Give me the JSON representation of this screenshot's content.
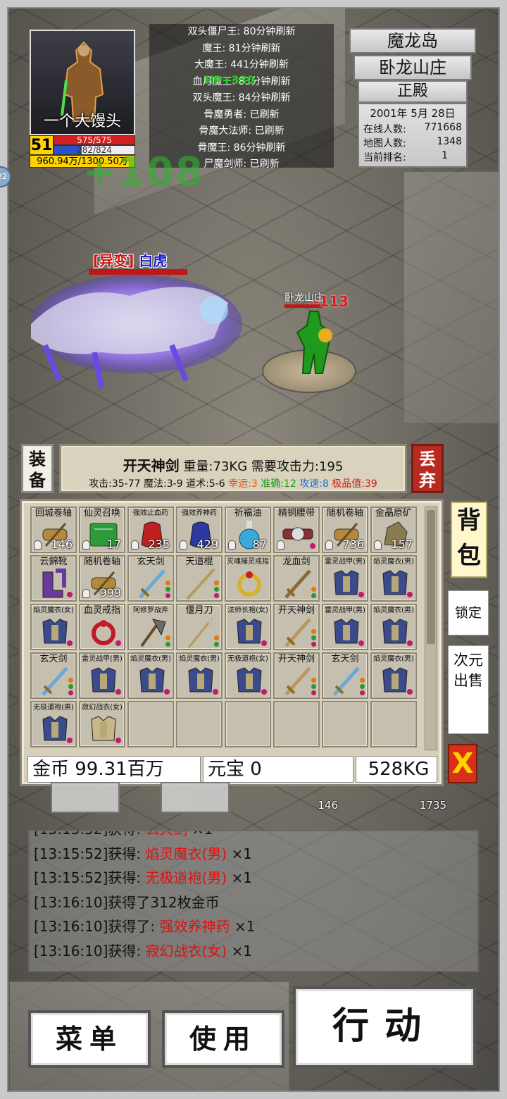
{
  "player": {
    "name": "一个大馒头",
    "level": "51",
    "hp": "575/575",
    "mp": "282/824",
    "exp": "960.94万/1300.50万"
  },
  "timers": [
    "双头僵尸王: 80分钟刷新",
    "魔王: 81分钟刷新",
    "大魔王: 441分钟刷新",
    "血月魔王: 83分钟刷新",
    "双头魔王: 84分钟刷新",
    "骨魔勇者: 已刷新",
    "骨魔大法师: 已刷新",
    "骨魔王: 86分钟刷新",
    "尸魔剑师: 已刷新"
  ],
  "location": {
    "region": "魔龙岛",
    "area": "卧龙山庄",
    "room": "正殿"
  },
  "info": {
    "date": "2001年 5月 28日",
    "online_label": "在线人数:",
    "online_value": "771668",
    "map_label": "地图人数:",
    "map_value": "1348",
    "rank_label": "当前排名:",
    "rank_value": "1"
  },
  "scene": {
    "float_gain": "HP+330",
    "float_big": "+108",
    "monster_tag": "[异变]",
    "monster_name": "白虎",
    "player_label": "卧龙山庄",
    "damage": "-113",
    "edge_badge": "22"
  },
  "item_panel": {
    "equip_label": "装备",
    "drop_label": "丢弃",
    "name": "开天神剑",
    "weight": "重量:73KG",
    "requirement": "需要攻击力:195",
    "attack": "攻击:35-77",
    "magic": "魔法:3-9",
    "tao": "道术:5-6",
    "luck": "幸运:3",
    "accuracy": "准确:12",
    "speed": "攻速:8",
    "grade": "极品值:39"
  },
  "inventory": [
    {
      "name": "回城卷轴",
      "qty": "146",
      "lock": true,
      "icon": "scroll-icon",
      "color": "#b48a3a"
    },
    {
      "name": "仙灵召唤",
      "qty": "17",
      "lock": true,
      "icon": "book-icon",
      "color": "#2e9a3a"
    },
    {
      "name": "强效止血药",
      "qty": "235",
      "lock": true,
      "icon": "potion-bag-icon",
      "color": "#c02020",
      "small": true
    },
    {
      "name": "强效养神药",
      "qty": "429",
      "lock": true,
      "icon": "potion-bag-icon",
      "color": "#2a3aa0",
      "small": true
    },
    {
      "name": "祈福油",
      "qty": "87",
      "lock": true,
      "icon": "flask-icon",
      "color": "#3aa8d8"
    },
    {
      "name": "精铜腰带",
      "lock": true,
      "icon": "belt-icon",
      "color": "#8a3030",
      "dot": "#c01a6a"
    },
    {
      "name": "随机卷轴",
      "qty": "736",
      "lock": true,
      "icon": "scroll-icon",
      "color": "#b48a3a"
    },
    {
      "name": "金晶原矿",
      "qty": "157",
      "lock": true,
      "icon": "ore-icon",
      "color": "#8a7a50"
    },
    {
      "name": "云錦靴",
      "icon": "boots-icon",
      "color": "#6a3a9a",
      "dot": "#c01a6a"
    },
    {
      "name": "随机卷轴",
      "qty": "999",
      "lock": true,
      "icon": "scroll-icon",
      "color": "#b48a3a"
    },
    {
      "name": "玄天剑",
      "icon": "sword-icon",
      "color": "#6aa8d8",
      "dots": [
        "#e07a10",
        "#2a9a2a",
        "#c01a6a"
      ]
    },
    {
      "name": "天道棍",
      "icon": "staff-icon",
      "color": "#b89a5a",
      "dots": [
        "#e07a10",
        "#2a9a2a",
        "#c01a6a"
      ]
    },
    {
      "name": "灭魂摧灵戒指",
      "icon": "ring-icon",
      "color": "#d8b030",
      "small": true
    },
    {
      "name": "龙血剑",
      "icon": "sword-icon",
      "color": "#8a6a3a",
      "dots": [
        "#e07a10",
        "#2a9a2a"
      ]
    },
    {
      "name": "雷灵战甲(男)",
      "icon": "armor-icon",
      "color": "#3a4a8a",
      "dot": "#c01a6a",
      "small": true
    },
    {
      "name": "焰灵魔衣(男)",
      "icon": "armor-icon",
      "color": "#3a4a8a",
      "dot": "#c01a6a",
      "small": true
    },
    {
      "name": "焰灵魔衣(女)",
      "icon": "armor-icon",
      "color": "#3a4a8a",
      "dot": "#c01a6a",
      "small": true
    },
    {
      "name": "血灵戒指",
      "icon": "ring-icon",
      "color": "#c01a2a",
      "dot": "#c01a6a"
    },
    {
      "name": "阿修罗战斧",
      "icon": "axe-icon",
      "color": "#6a6a6a",
      "dots": [
        "#e07a10",
        "#2a9a2a"
      ],
      "small": true
    },
    {
      "name": "偃月刀",
      "icon": "blade-icon",
      "color": "#b89a5a",
      "dots": [
        "#e07a10",
        "#2a9a2a"
      ]
    },
    {
      "name": "法师长袍(女)",
      "icon": "armor-icon",
      "color": "#3a4a8a",
      "dot": "#c01a6a",
      "small": true
    },
    {
      "name": "开天神剑",
      "icon": "sword-icon",
      "color": "#b89a5a",
      "dots": [
        "#e07a10",
        "#2a9a2a",
        "#c01a6a"
      ]
    },
    {
      "name": "雷灵战甲(男)",
      "icon": "armor-icon",
      "color": "#3a4a8a",
      "dot": "#c01a6a",
      "small": true
    },
    {
      "name": "焰灵魔衣(男)",
      "icon": "armor-icon",
      "color": "#3a4a8a",
      "dot": "#c01a6a",
      "small": true
    },
    {
      "name": "玄天剑",
      "icon": "sword-icon",
      "color": "#6aa8d8",
      "dots": [
        "#e07a10",
        "#2a9a2a",
        "#c01a6a"
      ]
    },
    {
      "name": "雷灵战甲(男)",
      "icon": "armor-icon",
      "color": "#3a4a8a",
      "dot": "#c01a6a",
      "small": true
    },
    {
      "name": "焰灵魔衣(男)",
      "icon": "armor-icon",
      "color": "#3a4a8a",
      "dot": "#c01a6a",
      "small": true
    },
    {
      "name": "焰灵魔衣(男)",
      "icon": "armor-icon",
      "color": "#3a4a8a",
      "dot": "#c01a6a",
      "small": true
    },
    {
      "name": "无极道袍(女)",
      "icon": "armor-icon",
      "color": "#3a4a8a",
      "dot": "#c01a6a",
      "small": true
    },
    {
      "name": "开天神剑",
      "icon": "sword-icon",
      "color": "#b89a5a",
      "dots": [
        "#e07a10",
        "#2a9a2a",
        "#c01a6a"
      ]
    },
    {
      "name": "玄天剑",
      "icon": "sword-icon",
      "color": "#6aa8d8",
      "dots": [
        "#e07a10",
        "#2a9a2a",
        "#c01a6a"
      ]
    },
    {
      "name": "焰灵魔衣(男)",
      "icon": "armor-icon",
      "color": "#3a4a8a",
      "dot": "#c01a6a",
      "small": true
    },
    {
      "name": "无极道袍(男)",
      "icon": "armor-icon",
      "color": "#3a4a8a",
      "dot": "#c01a6a",
      "small": true
    },
    {
      "name": "寂幻战衣(女)",
      "icon": "armor-icon",
      "color": "#c8b888",
      "dot": "#c01a6a",
      "small": true
    },
    {},
    {},
    {},
    {},
    {},
    {}
  ],
  "bag": {
    "gold": "金币 99.31百万",
    "ingot": "元宝 0",
    "weight": "528KG"
  },
  "side": {
    "bag_tab": "背包",
    "lock": "锁定",
    "sell": "次元出售",
    "close": "X"
  },
  "quickbar": [
    "146",
    "1735"
  ],
  "log": [
    {
      "prefix": "[13:15:52]获得: ",
      "item": "玄天剑",
      "suffix": " ×1"
    },
    {
      "prefix": "[13:15:52]获得: ",
      "item": "焰灵魔衣(男)",
      "suffix": " ×1"
    },
    {
      "prefix": "[13:15:52]获得: ",
      "item": "无极道袍(男)",
      "suffix": " ×1"
    },
    {
      "prefix": "[13:16:10]获得了312枚金币",
      "item": "",
      "suffix": ""
    },
    {
      "prefix": "[13:16:10]获得了: ",
      "item": "强效养神药",
      "suffix": " ×1"
    },
    {
      "prefix": "[13:16:10]获得: ",
      "item": "寂幻战衣(女)",
      "suffix": " ×1"
    }
  ],
  "buttons": {
    "menu": "菜单",
    "use": "使用",
    "action": "行动"
  }
}
